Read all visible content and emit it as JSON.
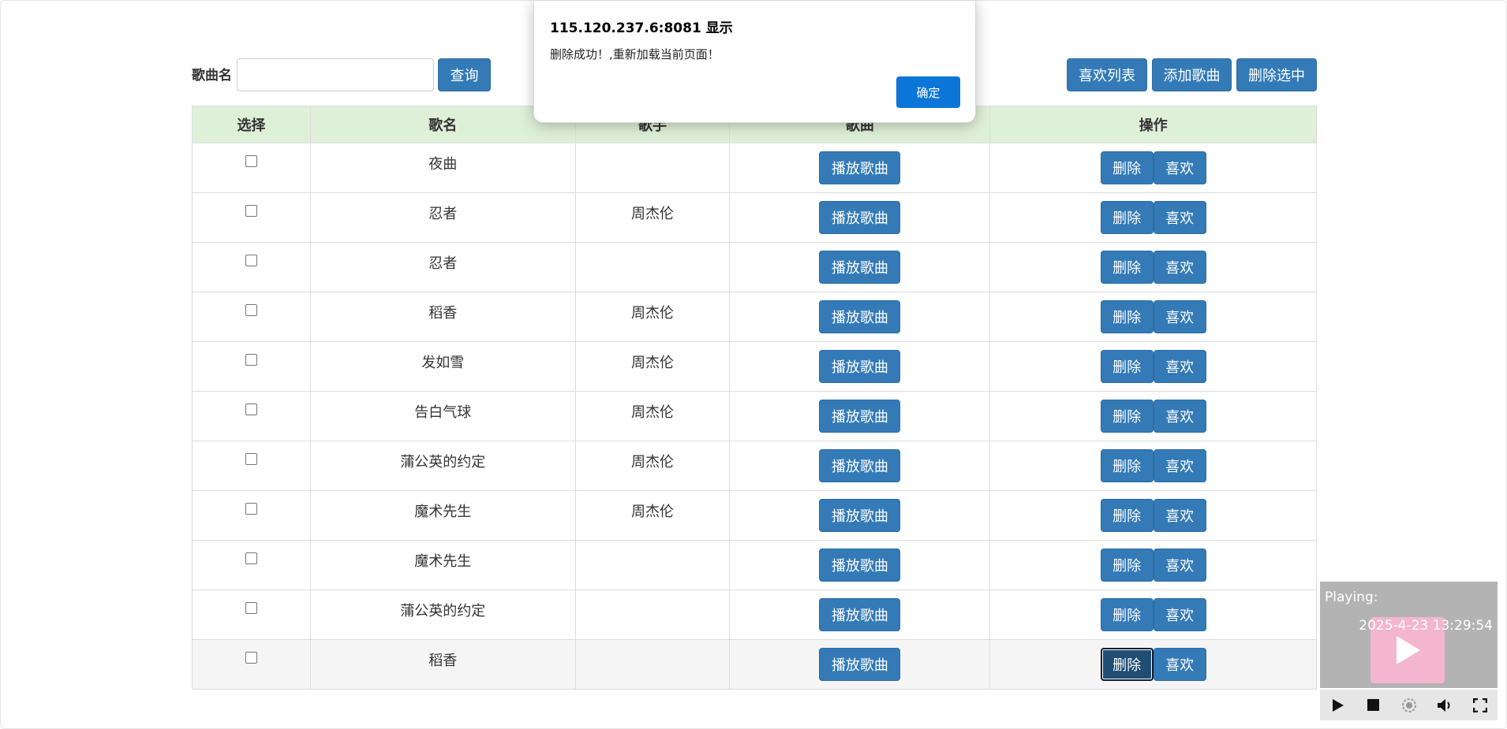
{
  "toolbar": {
    "search_label": "歌曲名",
    "search_value": "",
    "query_label": "查询",
    "fav_list_label": "喜欢列表",
    "add_song_label": "添加歌曲",
    "delete_selected_label": "删除选中"
  },
  "table": {
    "headers": [
      "选择",
      "歌名",
      "歌手",
      "歌曲",
      "操作"
    ],
    "play_label": "播放歌曲",
    "delete_label": "删除",
    "like_label": "喜欢",
    "rows": [
      {
        "name": "夜曲",
        "singer": ""
      },
      {
        "name": "忍者",
        "singer": "周杰伦"
      },
      {
        "name": "忍者",
        "singer": ""
      },
      {
        "name": "稻香",
        "singer": "周杰伦"
      },
      {
        "name": "发如雪",
        "singer": "周杰伦"
      },
      {
        "name": "告白气球",
        "singer": "周杰伦"
      },
      {
        "name": "蒲公英的约定",
        "singer": "周杰伦"
      },
      {
        "name": "魔术先生",
        "singer": "周杰伦"
      },
      {
        "name": "魔术先生",
        "singer": ""
      },
      {
        "name": "蒲公英的约定",
        "singer": ""
      },
      {
        "name": "稻香",
        "singer": ""
      }
    ]
  },
  "dialog": {
    "title": "115.120.237.6:8081 显示",
    "message": "删除成功！,重新加载当前页面！",
    "ok_label": "确定"
  },
  "player": {
    "playing_label": "Playing:",
    "time_text": "2025-4-23 13:29:54"
  },
  "colors": {
    "primary_button": "#337ab7",
    "header_bg": "#dff0d8",
    "dialog_ok": "#0b76d8",
    "player_bg": "#b3b3b3"
  }
}
